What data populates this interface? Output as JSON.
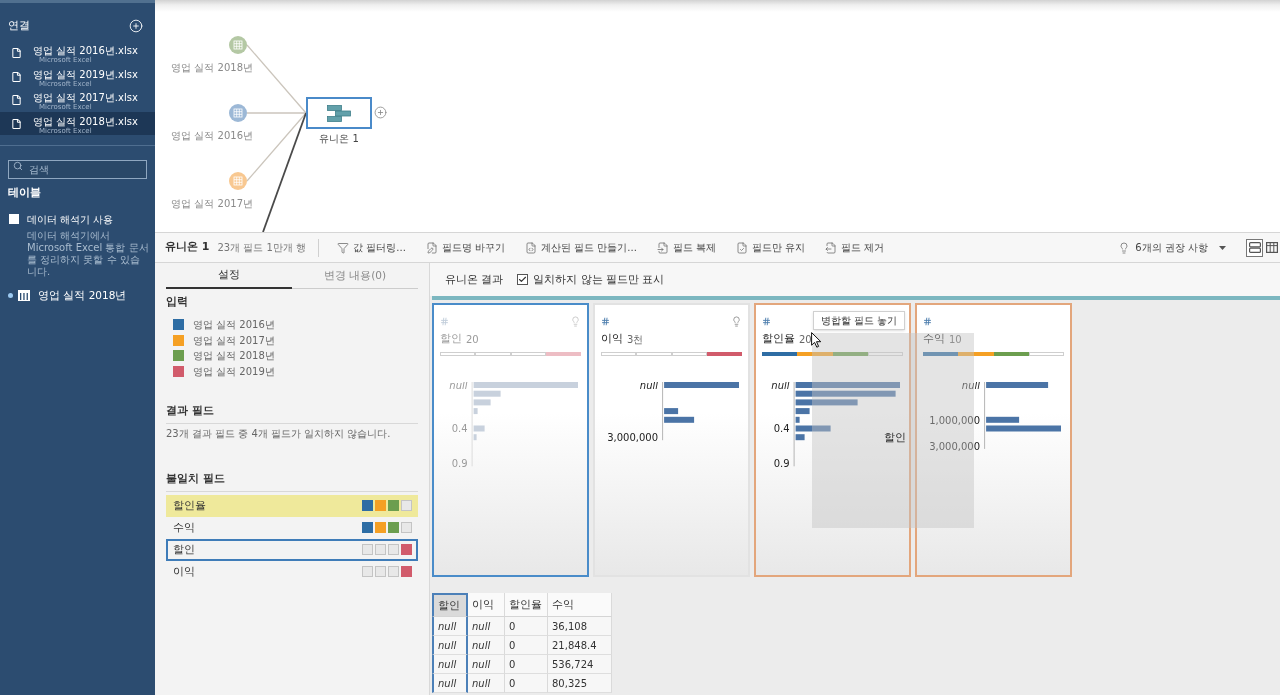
{
  "sidebar": {
    "connections_title": "연결",
    "files": [
      {
        "name": "영업 실적 2016년.xlsx",
        "type": "Microsoft Excel",
        "selected": false
      },
      {
        "name": "영업 실적 2019년.xlsx",
        "type": "Microsoft Excel",
        "selected": false
      },
      {
        "name": "영업 실적 2017년.xlsx",
        "type": "Microsoft Excel",
        "selected": false
      },
      {
        "name": "영업 실적 2018년.xlsx",
        "type": "Microsoft Excel",
        "selected": true
      }
    ],
    "search": {
      "placeholder": "검색"
    },
    "tables_title": "테이블",
    "interpreter": {
      "label": "데이터 해석기 사용",
      "checked": false,
      "note": "데이터 해석기에서 Microsoft Excel 통합 문서를 정리하지 못할 수 있습니다."
    },
    "tables": [
      {
        "name": "영업 실적 2018년"
      }
    ]
  },
  "flow": {
    "inputs": [
      {
        "label": "영업 실적 2018년",
        "color": "#b4c8a4"
      },
      {
        "label": "영업 실적 2016년",
        "color": "#9cb8d6"
      },
      {
        "label": "영업 실적 2017년",
        "color": "#f8c891"
      }
    ],
    "union": {
      "label": "유니온 1",
      "selected": true
    }
  },
  "toolbar": {
    "title": "유니온 1",
    "summary": "23개 필드 1만개 행",
    "actions": [
      {
        "kind": "filter",
        "label": "값 필터링..."
      },
      {
        "kind": "rename",
        "label": "필드명 바꾸기"
      },
      {
        "kind": "calculate",
        "label": "계산된 필드 만들기..."
      },
      {
        "kind": "duplicate",
        "label": "필드 복제"
      },
      {
        "kind": "keep",
        "label": "필드만 유지"
      },
      {
        "kind": "remove",
        "label": "필드 제거"
      }
    ],
    "recommendations": "6개의 권장 사항",
    "views": [
      {
        "kind": "cards",
        "selected": true
      },
      {
        "kind": "table",
        "selected": false
      }
    ]
  },
  "settings_panel": {
    "tabs": [
      {
        "label": "설정",
        "selected": true
      },
      {
        "label": "변경 내용(0)",
        "selected": false
      }
    ],
    "inputs_title": "입력",
    "inputs": [
      {
        "label": "영업 실적 2016년",
        "color": "#2e6da4"
      },
      {
        "label": "영업 실적 2017년",
        "color": "#f5a024"
      },
      {
        "label": "영업 실적 2018년",
        "color": "#6c9e4f"
      },
      {
        "label": "영업 실적 2019년",
        "color": "#d15b6b"
      }
    ],
    "result_title": "결과 필드",
    "result_note": "23개 결과 필드 중 4개 필드가 일치하지 않습니다.",
    "mismatch_title": "불일치 필드",
    "mismatched_fields": [
      {
        "name": "할인율",
        "highlighted": true,
        "selected": false,
        "sources": [
          true,
          true,
          true,
          false
        ]
      },
      {
        "name": "수익",
        "highlighted": false,
        "selected": false,
        "sources": [
          true,
          true,
          true,
          false
        ]
      },
      {
        "name": "할인",
        "highlighted": false,
        "selected": true,
        "sources": [
          false,
          false,
          false,
          true
        ]
      },
      {
        "name": "이익",
        "highlighted": false,
        "selected": false,
        "sources": [
          false,
          false,
          false,
          true
        ]
      }
    ]
  },
  "results": {
    "title": "유니온 결과",
    "mismatch_only": {
      "label": "일치하지 않는 필드만 표시",
      "checked": true
    },
    "cards": [
      {
        "name": "할인",
        "count": "20",
        "selected": true,
        "drop_target": false,
        "dimmed": true,
        "suggestion": true,
        "sources": [
          false,
          false,
          false,
          true
        ],
        "axis_labels": [
          "null",
          "0.4",
          "0.9"
        ]
      },
      {
        "name": "이익",
        "count": "3천",
        "selected": false,
        "drop_target": false,
        "dimmed": false,
        "suggestion": true,
        "sources": [
          false,
          false,
          false,
          true
        ],
        "axis_labels": [
          "null",
          "3,000,000"
        ]
      },
      {
        "name": "할인율",
        "count": "20",
        "selected": false,
        "drop_target": true,
        "dimmed": false,
        "suggestion": false,
        "sources": [
          true,
          true,
          true,
          false
        ],
        "axis_labels": [
          "null",
          "0.4",
          "0.9"
        ]
      },
      {
        "name": "수익",
        "count": "10",
        "selected": false,
        "drop_target": true,
        "dimmed": false,
        "suggestion": false,
        "sources": [
          true,
          true,
          true,
          false
        ],
        "axis_labels": [
          "null",
          "1,000,000",
          "3,000,000"
        ]
      }
    ],
    "drag": {
      "label": "할인",
      "tooltip": "병합할 필드 놓기"
    }
  },
  "grid": {
    "columns": [
      {
        "label": "할인",
        "selected": true
      },
      {
        "label": "이익",
        "selected": false
      },
      {
        "label": "할인율",
        "selected": false
      },
      {
        "label": "수익",
        "selected": false
      }
    ],
    "rows": [
      {
        "cells": [
          {
            "kind": "null",
            "text": "null"
          },
          {
            "kind": "null",
            "text": "null"
          },
          {
            "kind": "value",
            "text": "0"
          },
          {
            "kind": "value",
            "text": "36,108"
          }
        ]
      },
      {
        "cells": [
          {
            "kind": "null",
            "text": "null"
          },
          {
            "kind": "null",
            "text": "null"
          },
          {
            "kind": "value",
            "text": "0"
          },
          {
            "kind": "value",
            "text": "21,848.4"
          }
        ]
      },
      {
        "cells": [
          {
            "kind": "null",
            "text": "null"
          },
          {
            "kind": "null",
            "text": "null"
          },
          {
            "kind": "value",
            "text": "0"
          },
          {
            "kind": "value",
            "text": "536,724"
          }
        ]
      },
      {
        "cells": [
          {
            "kind": "null",
            "text": "null"
          },
          {
            "kind": "null",
            "text": "null"
          },
          {
            "kind": "value",
            "text": "0"
          },
          {
            "kind": "value",
            "text": "80,325"
          }
        ]
      }
    ]
  }
}
